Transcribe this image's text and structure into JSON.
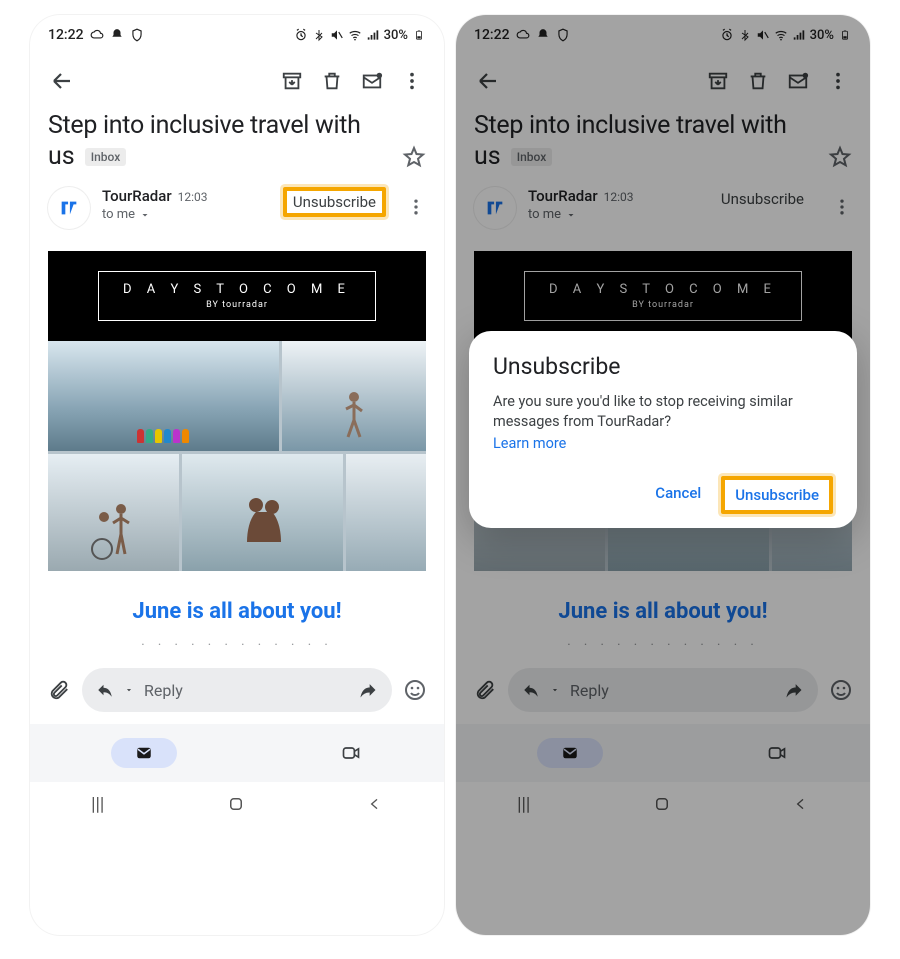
{
  "status": {
    "time": "12:22",
    "battery": "30%"
  },
  "email": {
    "subject_line1": "Step into inclusive travel with",
    "subject_line2": "us",
    "folder": "Inbox",
    "sender": "TourRadar",
    "sent_time": "12:03",
    "to_label": "to me",
    "unsubscribe": "Unsubscribe",
    "hero_line1": "D A Y S   T O   C O M E",
    "hero_line2": "BY tourradar",
    "headline": "June is all about you!"
  },
  "reply": {
    "placeholder": "Reply"
  },
  "dialog": {
    "title": "Unsubscribe",
    "body": "Are you sure you'd like to stop receiving similar messages from TourRadar?",
    "learn_more": "Learn more",
    "cancel": "Cancel",
    "confirm": "Unsubscribe"
  }
}
